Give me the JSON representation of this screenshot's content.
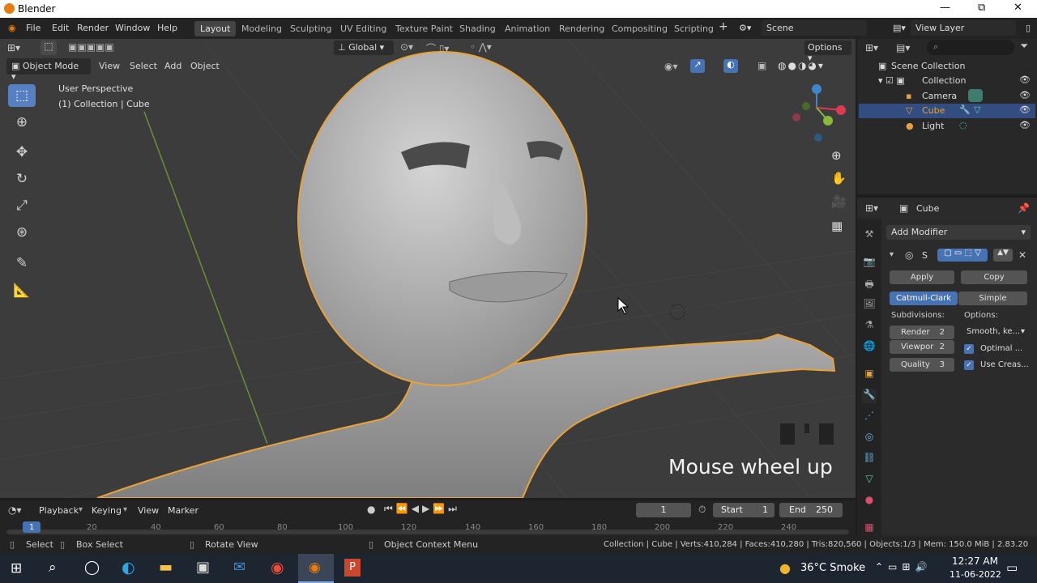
{
  "window": {
    "title": "Blender",
    "min": "—",
    "max": "⧉",
    "close": "✕"
  },
  "menu": [
    "File",
    "Edit",
    "Render",
    "Window",
    "Help"
  ],
  "workspaces": [
    "Layout",
    "Modeling",
    "Sculpting",
    "UV Editing",
    "Texture Paint",
    "Shading",
    "Animation",
    "Rendering",
    "Compositing",
    "Scripting"
  ],
  "topright": {
    "scene": "Scene",
    "view_layer": "View Layer"
  },
  "viewport_header": {
    "mode": "Object Mode",
    "view": "View",
    "select": "Select",
    "add": "Add",
    "object": "Object",
    "orientation": "Global",
    "options": "Options"
  },
  "viewport": {
    "perspective": "User Perspective",
    "context": "(1) Collection | Cube",
    "overlay_text": "Mouse wheel up"
  },
  "outliner": {
    "root": "Scene Collection",
    "items": [
      {
        "label": "Collection"
      },
      {
        "label": "Camera"
      },
      {
        "label": "Cube"
      },
      {
        "label": "Light"
      }
    ]
  },
  "properties": {
    "object_name": "Cube",
    "add_modifier": "Add Modifier",
    "modifier_short": "S",
    "apply": "Apply",
    "copy": "Copy",
    "catmull": "Catmull-Clark",
    "simple": "Simple",
    "subdivisions_label": "Subdivisions:",
    "options_label": "Options:",
    "render": {
      "label": "Render",
      "value": "2"
    },
    "viewport": {
      "label": "Viewpor",
      "value": "2"
    },
    "quality": {
      "label": "Quality",
      "value": "3"
    },
    "uv_smooth": "Smooth, ke...",
    "optimal": "Optimal ...",
    "use_crease": "Use Creas..."
  },
  "timeline": {
    "playback": "Playback",
    "keying": "Keying",
    "view": "View",
    "marker": "Marker",
    "current_frame": "1",
    "start_label": "Start",
    "start": "1",
    "end_label": "End",
    "end": "250",
    "ticks": [
      "1",
      "20",
      "40",
      "60",
      "80",
      "100",
      "120",
      "140",
      "160",
      "180",
      "200",
      "220",
      "240"
    ]
  },
  "statusbar": {
    "select": "Select",
    "box_select": "Box Select",
    "rotate_view": "Rotate View",
    "context_menu": "Object Context Menu",
    "stats": "Collection | Cube | Verts:410,284 | Faces:410,280 | Tris:820,560 | Objects:1/3 | Mem: 150.0 MiB | 2.83.20"
  },
  "taskbar": {
    "weather": "36°C  Smoke",
    "time": "12:27 AM",
    "date": "11-06-2022"
  },
  "colors": {
    "accent": "#4772b3",
    "selection_outline": "#e8a23a",
    "brand": "#e87d0d"
  }
}
